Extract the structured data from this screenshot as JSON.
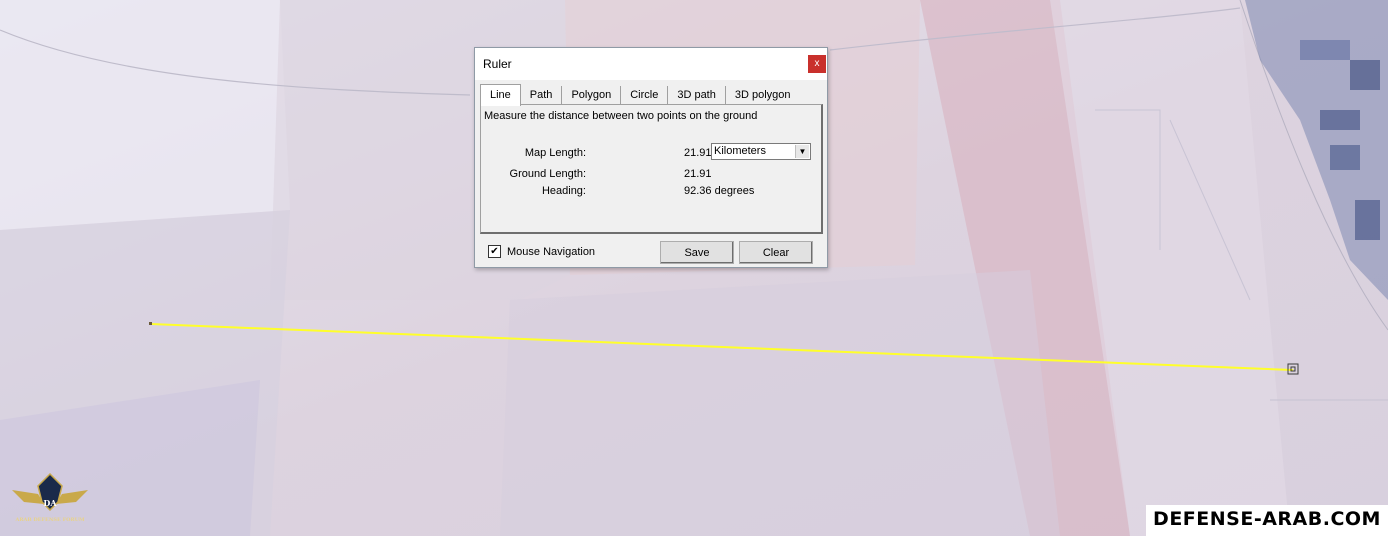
{
  "map": {
    "measured_line_color": "#ffff2a"
  },
  "ruler": {
    "title": "Ruler",
    "close_label": "x",
    "tabs": [
      {
        "label": "Line",
        "active": true
      },
      {
        "label": "Path",
        "active": false
      },
      {
        "label": "Polygon",
        "active": false
      },
      {
        "label": "Circle",
        "active": false
      },
      {
        "label": "3D path",
        "active": false
      },
      {
        "label": "3D polygon",
        "active": false
      }
    ],
    "description": "Measure the distance between two points on the ground",
    "map_length_label": "Map Length:",
    "map_length_value": "21.91",
    "unit_selected": "Kilometers",
    "ground_length_label": "Ground Length:",
    "ground_length_value": "21.91",
    "heading_label": "Heading:",
    "heading_value": "92.36 degrees",
    "mouse_navigation_label": "Mouse Navigation",
    "mouse_navigation_checked": true,
    "save_label": "Save",
    "clear_label": "Clear"
  },
  "logo": {
    "initials": "DA",
    "text": "ARAB DEFENSE FORUM"
  },
  "watermark": {
    "text": "DEFENSE-ARAB.COM"
  }
}
